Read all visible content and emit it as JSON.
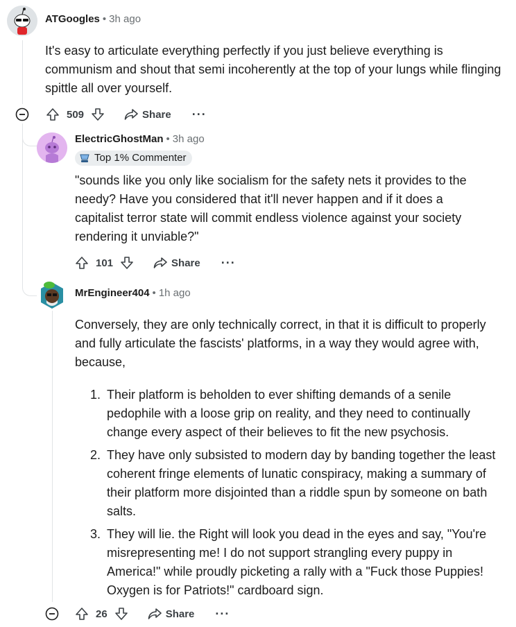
{
  "comments": [
    {
      "username": "ATGoogles",
      "time": "3h ago",
      "body": "It's easy to articulate everything perfectly if you just believe everything is communism and shout that semi incoherently at the top of your lungs while flinging spittle all over yourself.",
      "votes": "509",
      "share_label": "Share",
      "more_label": "···"
    },
    {
      "username": "ElectricGhostMan",
      "time": "3h ago",
      "badge": "Top 1% Commenter",
      "body": "\"sounds like you only like socialism for the safety nets it provides to the needy? Have you considered that it'll never happen and if it does a capitalist terror state will commit endless violence against your society rendering it unviable?\"",
      "votes": "101",
      "share_label": "Share",
      "more_label": "···"
    },
    {
      "username": "MrEngineer404",
      "time": "1h ago",
      "body_intro": "Conversely, they are only technically correct, in that it is difficult to properly and fully articulate the fascists' platforms, in a way they would agree with, because,",
      "list": [
        {
          "num": "1.",
          "text": "Their platform is beholden to ever shifting demands of a senile pedophile with a loose grip on reality, and they need to continually change every aspect of their believes to fit the new psychosis."
        },
        {
          "num": "2.",
          "text": "They have only subsisted to modern day by banding together the least coherent fringe elements of lunatic conspiracy, making a summary of their platform more disjointed than a riddle spun by someone on bath salts."
        },
        {
          "num": "3.",
          "text": "They will lie. the Right will look you dead in the eyes and say, \"You're misrepresenting me! I do not support strangling every puppy in America!\" while proudly picketing a rally with a \"Fuck those Puppies! Oxygen is for Patriots!\" cardboard sign."
        }
      ],
      "votes": "26",
      "share_label": "Share",
      "more_label": "···"
    }
  ],
  "separator": "•",
  "colors": {
    "text": "#1c1c1c",
    "meta": "#6a6f72",
    "thread": "#e1e4e6",
    "badge_bg": "#eaedef"
  },
  "icons": {
    "upvote": "arrow-up-icon",
    "downvote": "arrow-down-icon",
    "share": "share-icon",
    "collapse": "minus-circle-icon",
    "badge": "trophy-icon"
  }
}
